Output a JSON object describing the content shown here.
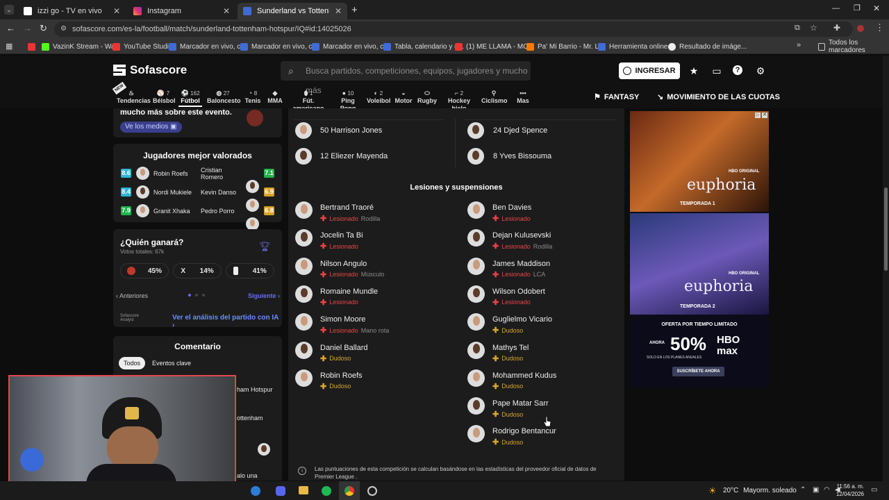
{
  "browser": {
    "tabs": [
      {
        "title": "izzi go - TV en vivo",
        "color": "#ffffff"
      },
      {
        "title": "Instagram",
        "color": "#e1306c"
      },
      {
        "title": "Sunderland vs Tottenham Hotsp",
        "color": "#3e6bd8"
      }
    ],
    "url": "sofascore.com/es-la/football/match/sunderland-tottenham-hotspur/IQ#id:14025026",
    "bookmarks": [
      "VazinK Stream - Wa...",
      "YouTube Studio",
      "Marcador en vivo, c...",
      "Marcador en vivo, c...",
      "Marcador en vivo, c...",
      "Tabla, calendario y e...",
      "(1) ME LLAMA - MO...",
      "Pa' Mi Barrio - Mr. L...",
      "Herramienta online...",
      "Resultado de imáge..."
    ],
    "all_bookmarks": "Todos los marcadores"
  },
  "site": {
    "logo": "Sofascore",
    "search_placeholder": "Busca partidos, competiciones, equipos, jugadores y mucho más",
    "login": "INGRESAR",
    "fantasy": "FANTASY",
    "odds": "MOVIMIENTO DE LAS CUOTAS",
    "sports": [
      {
        "name": "Tendencias",
        "count": ""
      },
      {
        "name": "Béisbol",
        "count": "7"
      },
      {
        "name": "Fútbol",
        "count": "162"
      },
      {
        "name": "Baloncesto",
        "count": "27"
      },
      {
        "name": "Tenis",
        "count": "8"
      },
      {
        "name": "MMA",
        "count": ""
      },
      {
        "name": "Fút. americano",
        "count": "1"
      },
      {
        "name": "Ping Pong",
        "count": "10"
      },
      {
        "name": "Voleibol",
        "count": "2"
      },
      {
        "name": "Motor",
        "count": ""
      },
      {
        "name": "Rugby",
        "count": ""
      },
      {
        "name": "Hockey hielo",
        "count": "2"
      },
      {
        "name": "Ciclismo",
        "count": ""
      },
      {
        "name": "Mas",
        "count": ""
      }
    ]
  },
  "left": {
    "media_text": "mucho más sobre este evento.",
    "media_button": "Ve los medios",
    "top_players_title": "Jugadores mejor valorados",
    "top_players": [
      {
        "home": "Robin Roefs",
        "home_rating": "8.6",
        "home_color": "#2db6d3",
        "away": "Cristian Romero",
        "away_rating": "7.1",
        "away_color": "#22b24c"
      },
      {
        "home": "Nordi Mukiele",
        "home_rating": "8.4",
        "home_color": "#2db6d3",
        "away": "Kevin Danso",
        "away_rating": "6.9",
        "away_color": "#d7a526"
      },
      {
        "home": "Granit Xhaka",
        "home_rating": "7.9",
        "home_color": "#22b24c",
        "away": "Pedro Porro",
        "away_rating": "6.8",
        "away_color": "#d7a526"
      }
    ],
    "who_wins_title": "¿Quién ganará?",
    "total_votes": "Votos totales: 67k",
    "vote_home": "45%",
    "vote_draw_label": "X",
    "vote_draw": "14%",
    "vote_away": "41%",
    "prev": "Anteriores",
    "next": "Siguiente",
    "ai_link": "Ver el análisis del partido con IA",
    "ai_brand": "Sofascore Analyst",
    "comments_title": "Comentario",
    "comments_tabs": [
      "Todos",
      "Eventos clave"
    ],
    "comment_snippets": [
      "ham Hotspur",
      "ottenham",
      "",
      "alo una"
    ]
  },
  "middle": {
    "bench_home": [
      "50 Harrison Jones",
      "12 Eliezer Mayenda"
    ],
    "bench_away": [
      "24 Djed Spence",
      "8 Yves Bissouma"
    ],
    "injuries_title": "Lesiones y suspensiones",
    "injuries_home": [
      {
        "name": "Bertrand Traoré",
        "status": "Lesionado",
        "detail": "Rodilla",
        "type": "injured"
      },
      {
        "name": "Jocelin Ta Bi",
        "status": "Lesionado",
        "detail": "",
        "type": "injured"
      },
      {
        "name": "Nilson Angulo",
        "status": "Lesionado",
        "detail": "Músculo",
        "type": "injured"
      },
      {
        "name": "Romaine Mundle",
        "status": "Lesionado",
        "detail": "",
        "type": "injured"
      },
      {
        "name": "Simon Moore",
        "status": "Lesionado",
        "detail": "Mano rota",
        "type": "injured"
      },
      {
        "name": "Daniel Ballard",
        "status": "Dudoso",
        "detail": "",
        "type": "doubtful"
      },
      {
        "name": "Robin Roefs",
        "status": "Dudoso",
        "detail": "",
        "type": "doubtful"
      }
    ],
    "injuries_away": [
      {
        "name": "Ben Davies",
        "status": "Lesionado",
        "detail": "",
        "type": "injured"
      },
      {
        "name": "Dejan Kulusevski",
        "status": "Lesionado",
        "detail": "Rodilla",
        "type": "injured"
      },
      {
        "name": "James Maddison",
        "status": "Lesionado",
        "detail": "LCA",
        "type": "injured"
      },
      {
        "name": "Wilson Odobert",
        "status": "Lesionado",
        "detail": "",
        "type": "injured"
      },
      {
        "name": "Guglielmo Vicario",
        "status": "Dudoso",
        "detail": "",
        "type": "doubtful"
      },
      {
        "name": "Mathys Tel",
        "status": "Dudoso",
        "detail": "",
        "type": "doubtful"
      },
      {
        "name": "Mohammed Kudus",
        "status": "Dudoso",
        "detail": "",
        "type": "doubtful"
      },
      {
        "name": "Pape Matar Sarr",
        "status": "Dudoso",
        "detail": "",
        "type": "doubtful"
      },
      {
        "name": "Rodrigo Bentancur",
        "status": "Dudoso",
        "detail": "",
        "type": "doubtful"
      }
    ],
    "footnote": "Las puntuaciones de esta competición se calculan basándose en las estadísticas del proveedor oficial de datos de Premier League ."
  },
  "ad": {
    "brand1": "euphoria",
    "hbo_original": "HBO ORIGINAL",
    "season1": "TEMPORADA 1",
    "season2": "TEMPORADA 2",
    "offer": "OFERTA POR TIEMPO LIMITADO",
    "ahora": "AHORA",
    "discount": "50%",
    "solo": "SOLO EN LOS PLANES ANUALES",
    "max": "HBO max",
    "cta": "SUSCRÍBETE AHORA"
  },
  "taskbar": {
    "weather_temp": "20°C",
    "weather_desc": "Mayorm. soleado",
    "time": "11:56 a. m.",
    "date": "12/04/2026"
  }
}
